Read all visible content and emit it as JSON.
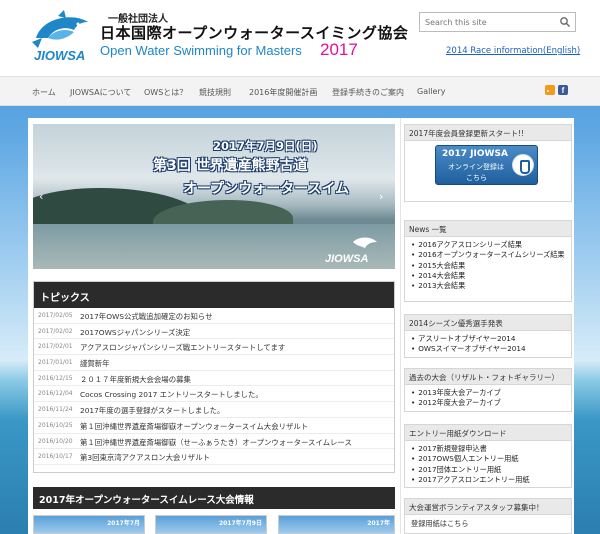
{
  "header": {
    "org_sub": "一般社団法人",
    "org_name": "日本国際オープンウォータースイミング協会",
    "tagline": "Open Water Swimming for Masters",
    "year": "2017",
    "logo_text": "JIOWSA",
    "search_placeholder": "Search this site",
    "race_info_link": "2014 Race information(English)"
  },
  "nav": {
    "items": [
      "ホーム",
      "JIOWSAについて",
      "OWSとは？",
      "競技規則",
      "2016年度開催計画",
      "登録手続きのご案内",
      "Gallery"
    ]
  },
  "slider": {
    "date": "2017年7月9日(日)",
    "line2": "第3回 世界遺産熊野古道",
    "line3": "オープンウォータースイム",
    "logo_text": "JIOWSA"
  },
  "topics": {
    "heading": "トピックス",
    "items": [
      {
        "date": "2017/02/05",
        "title": "2017年OWS公式戦追加確定のお知らせ"
      },
      {
        "date": "2017/02/02",
        "title": "2017OWSジャパンシリーズ決定"
      },
      {
        "date": "2017/02/01",
        "title": "アクアスロンジャパンシリーズ戦エントリースタートしてます"
      },
      {
        "date": "2017/01/01",
        "title": "謹賀新年"
      },
      {
        "date": "2016/12/15",
        "title": "２０１７年度新規大会会場の募集"
      },
      {
        "date": "2016/12/04",
        "title": "Cocos Crossing 2017 エントリースタートしました。"
      },
      {
        "date": "2016/11/24",
        "title": "2017年度の選手登録がスタートしました。"
      },
      {
        "date": "2016/10/25",
        "title": "第１回沖縄世界遺産斎場御嶽オープンウォータースイム大会リザルト"
      },
      {
        "date": "2016/10/20",
        "title": "第１回沖縄世界遺産斎場御嶽（せーふぁうたき）オープンウォータースイムレース"
      },
      {
        "date": "2016/10/17",
        "title": "第3回東京湾アクアスロン大会リザルト"
      }
    ]
  },
  "race_info": {
    "heading": "2017年オープンウォータースイムレース大会情報",
    "thumbs": [
      "2017年7月",
      "2017年7月9日",
      "2017年"
    ]
  },
  "sidebar": {
    "registration": {
      "heading": "2017年度会員登録更新スタート!!",
      "button_line1": "2017 JIOWSA",
      "button_line2": "オンライン登録は",
      "button_line3": "こちら"
    },
    "news": {
      "heading": "News 一覧",
      "items": [
        "2016アクアスロンシリーズ結果",
        "2016オープンウォータースイムシリーズ結果",
        "2015大会結果",
        "2014大会結果",
        "2013大会結果"
      ]
    },
    "season": {
      "heading": "2014シーズン優秀選手発表",
      "items": [
        "アスリートオブザイヤー2014",
        "OWSスイマーオブザイヤー2014"
      ]
    },
    "past": {
      "heading": "過去の大会（リザルト・フォトギャラリー）",
      "items": [
        "2013年度大会アーカイブ",
        "2012年度大会アーカイブ"
      ]
    },
    "entry": {
      "heading": "エントリー用紙ダウンロード",
      "items": [
        "2017新規登録申込書",
        "2017OWS個人エントリー用紙",
        "2017団体エントリー用紙",
        "2017アクアスロンエントリー用紙"
      ]
    },
    "volunteer": {
      "heading": "大会運営ボランティアスタッフ募集中！",
      "text": "登録用紙はこちら"
    }
  },
  "colors": {
    "brand_blue": "#1f86c8",
    "year_magenta": "#e0119c",
    "dark_bar": "#2b2b2b",
    "link_blue": "#1a5fc4"
  }
}
